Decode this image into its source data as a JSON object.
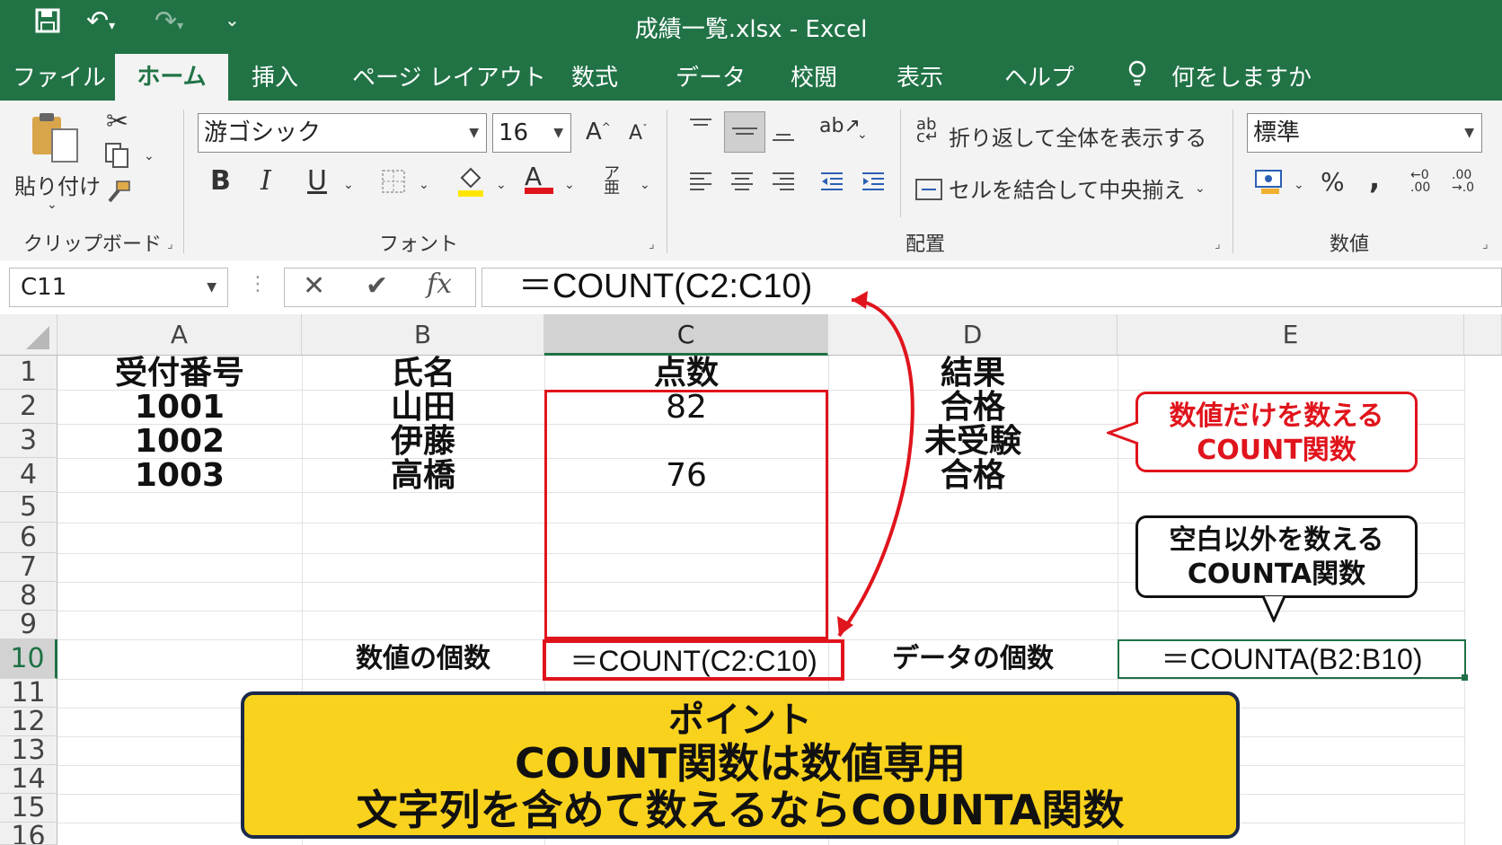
{
  "window": {
    "title": "成績一覧.xlsx  -  Excel"
  },
  "colors": {
    "excel_green": "#217346",
    "highlight_red": "#e0141c",
    "note_yellow": "#f9d21e",
    "selected_green": "#1e7145"
  },
  "tabs": [
    "ファイル",
    "ホーム",
    "挿入",
    "ページ レイアウト",
    "数式",
    "データ",
    "校閲",
    "表示",
    "ヘルプ"
  ],
  "tell_me": "何をしますか",
  "ribbon": {
    "clipboard": {
      "paste_label": "貼り付け",
      "group_label": "クリップボード"
    },
    "font": {
      "name": "游ゴシック",
      "size": "16",
      "group_label": "フォント",
      "bold": "B",
      "italic": "I",
      "underline": "U",
      "color_a": "A"
    },
    "alignment": {
      "wrap_text": "折り返して全体を表示する",
      "merge_center": "セルを結合して中央揃え",
      "group_label": "配置"
    },
    "number": {
      "format": "標準",
      "percent": "%",
      "comma": ",",
      "group_label": "数値"
    }
  },
  "formula_bar": {
    "name_box": "C11",
    "formula": "＝COUNT(C2:C10)",
    "fx": "fx"
  },
  "columns": [
    "A",
    "B",
    "C",
    "D",
    "E"
  ],
  "rows": [
    "1",
    "2",
    "3",
    "4",
    "5",
    "6",
    "7",
    "8",
    "9",
    "10",
    "11",
    "12",
    "13",
    "14",
    "15",
    "16"
  ],
  "sheet": {
    "headers": {
      "a": "受付番号",
      "b": "氏名",
      "c": "点数",
      "d": "結果"
    },
    "data": [
      {
        "a": "1001",
        "b": "山田",
        "c": "82",
        "d": "合格"
      },
      {
        "a": "1002",
        "b": "伊藤",
        "c": "",
        "d": "未受験"
      },
      {
        "a": "1003",
        "b": "高橋",
        "c": "76",
        "d": "合格"
      }
    ],
    "row10": {
      "b_label": "数値の個数",
      "c_formula": "＝COUNT(C2:C10)",
      "d_label": "データの個数",
      "e_formula": "＝COUNTA(B2:B10)"
    }
  },
  "callouts": {
    "count": {
      "line1": "数値だけを数える",
      "line2": "COUNT関数"
    },
    "counta": {
      "line1": "空白以外を数える",
      "line2": "COUNTA関数"
    },
    "point": {
      "line1": "ポイント",
      "line2": "COUNT関数は数値専用",
      "line3": "文字列を含めて数えるならCOUNTA関数"
    }
  }
}
